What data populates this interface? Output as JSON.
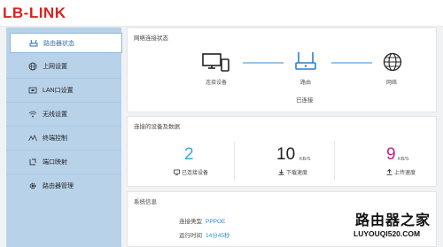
{
  "header": {
    "logo_text": "LB-LINK"
  },
  "sidebar": {
    "items": [
      {
        "label": "路由器状态",
        "icon": "router-status-icon",
        "active": true
      },
      {
        "label": "上网设置",
        "icon": "globe-icon"
      },
      {
        "label": "LAN口设置",
        "icon": "lan-port-icon"
      },
      {
        "label": "无线设置",
        "icon": "wifi-icon"
      },
      {
        "label": "终端控制",
        "icon": "activity-icon"
      },
      {
        "label": "端口映射",
        "icon": "port-mapping-icon"
      },
      {
        "label": "路由器管理",
        "icon": "gear-icon"
      }
    ]
  },
  "network_status": {
    "title": "网络连接状态",
    "devices_label": "连接设备",
    "router_label": "路由",
    "internet_label": "网络",
    "status": "已连接"
  },
  "devices_data": {
    "title": "连接的设备及数据",
    "connected_count": "2",
    "connected_label": "已连接设备",
    "download_value": "10",
    "download_unit": "KB/S",
    "download_label": "下载速度",
    "upload_value": "9",
    "upload_unit": "KB/S",
    "upload_label": "上传速度",
    "colors": {
      "count": "#3aa7d8",
      "download": "#222222",
      "upload": "#c8207e"
    }
  },
  "system_info": {
    "title": "系统信息",
    "connection_type_label": "连接类型",
    "connection_type_value": "PPPOE",
    "uptime_label": "运行时间",
    "uptime_value": "14分45秒"
  },
  "watermark": {
    "title": "路由器之家",
    "url": "LUYOUQI520.COM"
  }
}
